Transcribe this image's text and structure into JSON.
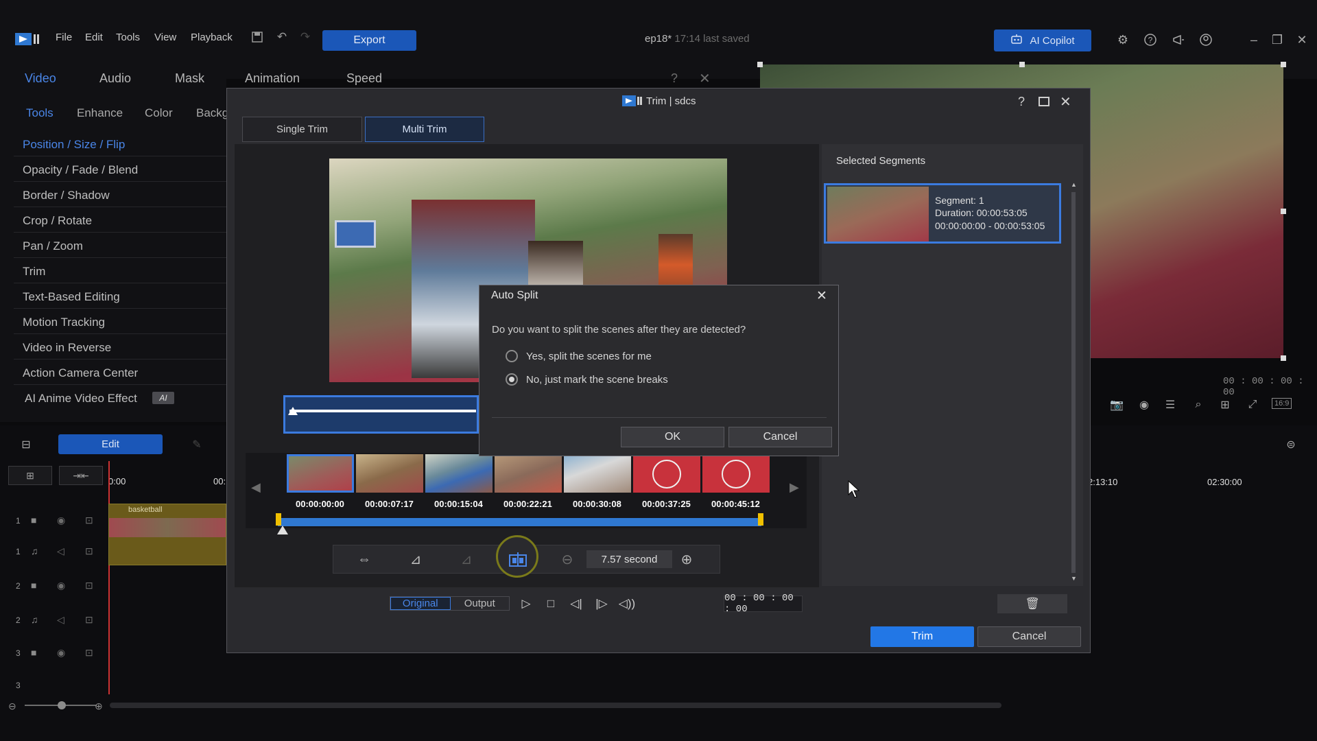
{
  "menubar": {
    "menus": [
      "File",
      "Edit",
      "Tools",
      "View",
      "Playback"
    ],
    "export_label": "Export",
    "title": "ep18*",
    "title_status": "17:14 last saved",
    "copilot_label": "AI Copilot"
  },
  "left_panel": {
    "tabs": [
      "Video",
      "Audio",
      "Mask",
      "Animation",
      "Speed"
    ],
    "sub_tabs": [
      "Tools",
      "Enhance",
      "Color",
      "Backg"
    ],
    "tools": [
      "Position / Size / Flip",
      "Opacity / Fade / Blend",
      "Border / Shadow",
      "Crop / Rotate",
      "Pan / Zoom",
      "Trim",
      "Text-Based Editing",
      "Motion Tracking",
      "Video in Reverse",
      "Action Camera Center",
      "AI Anime Video Effect"
    ],
    "ai_badge": "AI"
  },
  "timeline": {
    "edit_label": "Edit",
    "time_start": "0:00",
    "time_partial": "00:",
    "clip_label": "basketball",
    "ruler_right": [
      "2:13:10",
      "02:30:00"
    ],
    "tracks": [
      "1",
      "1",
      "2",
      "2",
      "3",
      "3"
    ]
  },
  "preview": {
    "timecode": "00 : 00 : 00 : 00",
    "aspect": "16:9"
  },
  "trim_dialog": {
    "title": "Trim | sdcs",
    "tabs": [
      "Single Trim",
      "Multi Trim"
    ],
    "selected_segments_label": "Selected Segments",
    "segment": {
      "name": "Segment: 1",
      "duration": "Duration: 00:00:53:05",
      "range": "00:00:00:00 - 00:00:53:05"
    },
    "thumb_times": [
      "00:00:00:00",
      "00:00:07:17",
      "00:00:15:04",
      "00:00:22:21",
      "00:00:30:08",
      "00:00:37:25",
      "00:00:45:12"
    ],
    "zoom_value": "7.57 second",
    "modes": [
      "Original",
      "Output"
    ],
    "timecode": "00 : 00 : 00 : 00",
    "trim_label": "Trim",
    "cancel_label": "Cancel"
  },
  "auto_split": {
    "title": "Auto Split",
    "question": "Do you want to split the scenes after they are detected?",
    "options": [
      "Yes, split the scenes for me",
      "No, just mark the scene breaks"
    ],
    "selected_index": 1,
    "ok_label": "OK",
    "cancel_label": "Cancel"
  }
}
